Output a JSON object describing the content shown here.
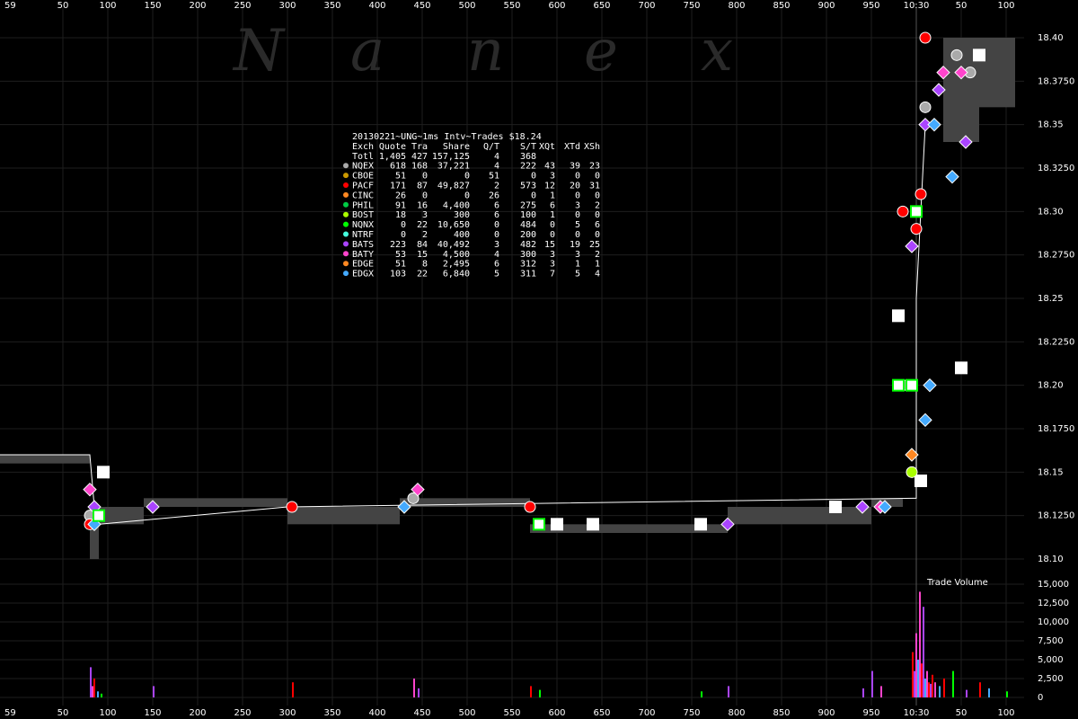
{
  "colors": {
    "background": "#000000",
    "grid": "#1e1e1e",
    "nbbo_band": "#444444",
    "trade_line": "#ffffff",
    "watermark": "#2a2a2a"
  },
  "watermark_letters": [
    "N",
    "a",
    "n",
    "e",
    "x"
  ],
  "chart_data": [
    {
      "type": "scatter",
      "title": "20130221~UNG~1ms Intv~Trades $18.24",
      "x_tick_labels": [
        "59",
        "50",
        "100",
        "150",
        "200",
        "250",
        "300",
        "350",
        "400",
        "450",
        "500",
        "550",
        "600",
        "650",
        "700",
        "750",
        "800",
        "850",
        "900",
        "950",
        "10:30",
        "50",
        "100"
      ],
      "y_tick_labels": [
        "18.40",
        "18.3750",
        "18.35",
        "18.3250",
        "18.30",
        "18.2750",
        "18.25",
        "18.2250",
        "18.20",
        "18.1750",
        "18.15",
        "18.1250",
        "18.10"
      ],
      "ylim": [
        18.1,
        18.4
      ],
      "nbbo_band": [
        {
          "x0": -75,
          "x1": 80,
          "bid": 18.155,
          "ask": 18.16
        },
        {
          "x0": 80,
          "x1": 90,
          "bid": 18.1,
          "ask": 18.13
        },
        {
          "x0": 90,
          "x1": 140,
          "bid": 18.12,
          "ask": 18.13
        },
        {
          "x0": 140,
          "x1": 300,
          "bid": 18.13,
          "ask": 18.135
        },
        {
          "x0": 300,
          "x1": 425,
          "bid": 18.12,
          "ask": 18.13
        },
        {
          "x0": 425,
          "x1": 570,
          "bid": 18.13,
          "ask": 18.135
        },
        {
          "x0": 570,
          "x1": 790,
          "bid": 18.115,
          "ask": 18.12
        },
        {
          "x0": 790,
          "x1": 950,
          "bid": 18.12,
          "ask": 18.13
        },
        {
          "x0": 950,
          "x1": 985,
          "bid": 18.13,
          "ask": 18.135
        },
        {
          "x0": 1030,
          "x1": 1070,
          "bid": 18.34,
          "ask": 18.4
        },
        {
          "x0": 1070,
          "x1": 1110,
          "bid": 18.36,
          "ask": 18.4
        }
      ],
      "series": [
        {
          "name": "NQEX",
          "color": "#aaaaaa",
          "shape": "circle",
          "points": [
            [
              80,
              18.125
            ],
            [
              440,
              18.135
            ],
            [
              1045,
              18.39
            ],
            [
              1010,
              18.36
            ],
            [
              1060,
              18.38
            ],
            [
              985,
              18.2
            ]
          ]
        },
        {
          "name": "PACF",
          "color": "#ff0000",
          "shape": "circle",
          "points": [
            [
              80,
              18.12
            ],
            [
              305,
              18.13
            ],
            [
              570,
              18.13
            ],
            [
              985,
              18.3
            ],
            [
              1010,
              18.4
            ],
            [
              1000,
              18.29
            ],
            [
              1005,
              18.31
            ]
          ]
        },
        {
          "name": "BATS",
          "color": "#aa44ff",
          "shape": "diamond",
          "points": [
            [
              85,
              18.13
            ],
            [
              150,
              18.13
            ],
            [
              790,
              18.12
            ],
            [
              940,
              18.13
            ],
            [
              1010,
              18.35
            ],
            [
              1025,
              18.37
            ],
            [
              1055,
              18.34
            ],
            [
              995,
              18.28
            ]
          ]
        },
        {
          "name": "BATY",
          "color": "#ff44cc",
          "shape": "diamond",
          "points": [
            [
              80,
              18.14
            ],
            [
              445,
              18.14
            ],
            [
              960,
              18.13
            ],
            [
              1030,
              18.38
            ],
            [
              1050,
              18.38
            ]
          ]
        },
        {
          "name": "EDGX",
          "color": "#44aaff",
          "shape": "diamond",
          "points": [
            [
              85,
              18.12
            ],
            [
              430,
              18.13
            ],
            [
              965,
              18.13
            ],
            [
              1020,
              18.35
            ],
            [
              1040,
              18.32
            ],
            [
              1015,
              18.2
            ],
            [
              1010,
              18.18
            ]
          ]
        },
        {
          "name": "NQNX",
          "color": "#00ff00",
          "shape": "square",
          "points": [
            [
              90,
              18.125
            ],
            [
              580,
              18.12
            ],
            [
              1000,
              18.3
            ],
            [
              995,
              18.2
            ],
            [
              980,
              18.2
            ]
          ]
        },
        {
          "name": "NTRF",
          "color": "#ffffff",
          "shape": "square",
          "points": [
            [
              95,
              18.15
            ],
            [
              600,
              18.12
            ],
            [
              640,
              18.12
            ],
            [
              760,
              18.12
            ],
            [
              910,
              18.13
            ],
            [
              1070,
              18.39
            ],
            [
              1050,
              18.21
            ],
            [
              1005,
              18.145
            ],
            [
              980,
              18.24
            ]
          ]
        },
        {
          "name": "EDGE",
          "color": "#ff8822",
          "shape": "diamond",
          "points": [
            [
              995,
              18.16
            ]
          ]
        },
        {
          "name": "BOST",
          "color": "#aaff00",
          "shape": "circle",
          "points": [
            [
              995,
              18.15
            ]
          ]
        }
      ],
      "trade_line": [
        [
          -75,
          18.16
        ],
        [
          80,
          18.16
        ],
        [
          85,
          18.13
        ],
        [
          90,
          18.12
        ],
        [
          300,
          18.13
        ],
        [
          1000,
          18.135
        ],
        [
          1000,
          18.25
        ],
        [
          1005,
          18.3
        ],
        [
          1010,
          18.35
        ]
      ],
      "stats_table": {
        "header": [
          "Exch",
          "Quote",
          "Tra",
          "Share",
          "Q/T",
          "S/T",
          "XQt",
          "XTd",
          "XSh"
        ],
        "rows": [
          {
            "exch": "Totl",
            "color": "",
            "cells": [
              "Totl",
              "1,405",
              "427",
              "157,125",
              "4",
              "368",
              "",
              "",
              ""
            ]
          },
          {
            "exch": "NQEX",
            "color": "#aaaaaa",
            "cells": [
              "NQEX",
              "618",
              "168",
              "37,221",
              "4",
              "222",
              "43",
              "39",
              "23"
            ]
          },
          {
            "exch": "CBOE",
            "color": "#cc9900",
            "cells": [
              "CBOE",
              "51",
              "0",
              "0",
              "51",
              "0",
              "3",
              "0",
              "0"
            ]
          },
          {
            "exch": "PACF",
            "color": "#ff0000",
            "cells": [
              "PACF",
              "171",
              "87",
              "49,827",
              "2",
              "573",
              "12",
              "20",
              "31"
            ]
          },
          {
            "exch": "CINC",
            "color": "#ff8822",
            "cells": [
              "CINC",
              "26",
              "0",
              "0",
              "26",
              "0",
              "1",
              "0",
              "0"
            ]
          },
          {
            "exch": "PHIL",
            "color": "#00cc44",
            "cells": [
              "PHIL",
              "91",
              "16",
              "4,400",
              "6",
              "275",
              "6",
              "3",
              "2"
            ]
          },
          {
            "exch": "BOST",
            "color": "#aaff00",
            "cells": [
              "BOST",
              "18",
              "3",
              "300",
              "6",
              "100",
              "1",
              "0",
              "0"
            ]
          },
          {
            "exch": "NQNX",
            "color": "#00ff00",
            "cells": [
              "NQNX",
              "0",
              "22",
              "10,650",
              "0",
              "484",
              "0",
              "5",
              "6"
            ]
          },
          {
            "exch": "NTRF",
            "color": "#44ffdd",
            "cells": [
              "NTRF",
              "0",
              "2",
              "400",
              "0",
              "200",
              "0",
              "0",
              "0"
            ]
          },
          {
            "exch": "BATS",
            "color": "#aa44ff",
            "cells": [
              "BATS",
              "223",
              "84",
              "40,492",
              "3",
              "482",
              "15",
              "19",
              "25"
            ]
          },
          {
            "exch": "BATY",
            "color": "#ff44cc",
            "cells": [
              "BATY",
              "53",
              "15",
              "4,500",
              "4",
              "300",
              "3",
              "3",
              "2"
            ]
          },
          {
            "exch": "EDGE",
            "color": "#ff8822",
            "cells": [
              "EDGE",
              "51",
              "8",
              "2,495",
              "6",
              "312",
              "3",
              "1",
              "1"
            ]
          },
          {
            "exch": "EDGX",
            "color": "#44aaff",
            "cells": [
              "EDGX",
              "103",
              "22",
              "6,840",
              "5",
              "311",
              "7",
              "5",
              "4"
            ]
          }
        ]
      }
    },
    {
      "type": "bar",
      "title": "Trade Volume",
      "y_tick_labels": [
        "15,000",
        "12,500",
        "10,000",
        "7,500",
        "5,000",
        "2,500",
        "0"
      ],
      "ylim": [
        0,
        15000
      ],
      "bars": [
        [
          80,
          4000,
          "#aa44ff"
        ],
        [
          82,
          1500,
          "#ff44cc"
        ],
        [
          84,
          2500,
          "#ff0000"
        ],
        [
          88,
          800,
          "#44aaff"
        ],
        [
          92,
          500,
          "#00ff00"
        ],
        [
          150,
          1500,
          "#aa44ff"
        ],
        [
          305,
          2000,
          "#ff0000"
        ],
        [
          440,
          2500,
          "#ff44cc"
        ],
        [
          445,
          1200,
          "#aa44ff"
        ],
        [
          570,
          1500,
          "#ff0000"
        ],
        [
          580,
          1000,
          "#00ff00"
        ],
        [
          760,
          800,
          "#00ff00"
        ],
        [
          790,
          1500,
          "#aa44ff"
        ],
        [
          940,
          1200,
          "#aa44ff"
        ],
        [
          950,
          3500,
          "#aa44ff"
        ],
        [
          960,
          1500,
          "#ff44cc"
        ],
        [
          995,
          6000,
          "#ff0000"
        ],
        [
          997,
          3500,
          "#aa44ff"
        ],
        [
          999,
          8500,
          "#ff44cc"
        ],
        [
          1001,
          5000,
          "#44aaff"
        ],
        [
          1003,
          14000,
          "#ff44cc"
        ],
        [
          1005,
          4500,
          "#ff0000"
        ],
        [
          1007,
          12000,
          "#aa44ff"
        ],
        [
          1009,
          2500,
          "#44aaff"
        ],
        [
          1011,
          3500,
          "#ff44cc"
        ],
        [
          1013,
          2000,
          "#ff0000"
        ],
        [
          1015,
          1800,
          "#aa44ff"
        ],
        [
          1017,
          3000,
          "#ff0000"
        ],
        [
          1020,
          2000,
          "#ff44cc"
        ],
        [
          1025,
          1500,
          "#44aaff"
        ],
        [
          1030,
          2500,
          "#ff0000"
        ],
        [
          1040,
          3500,
          "#00ff00"
        ],
        [
          1055,
          1000,
          "#aa44ff"
        ],
        [
          1070,
          2000,
          "#ff0000"
        ],
        [
          1080,
          1200,
          "#44aaff"
        ],
        [
          1100,
          800,
          "#00ff00"
        ]
      ]
    }
  ]
}
